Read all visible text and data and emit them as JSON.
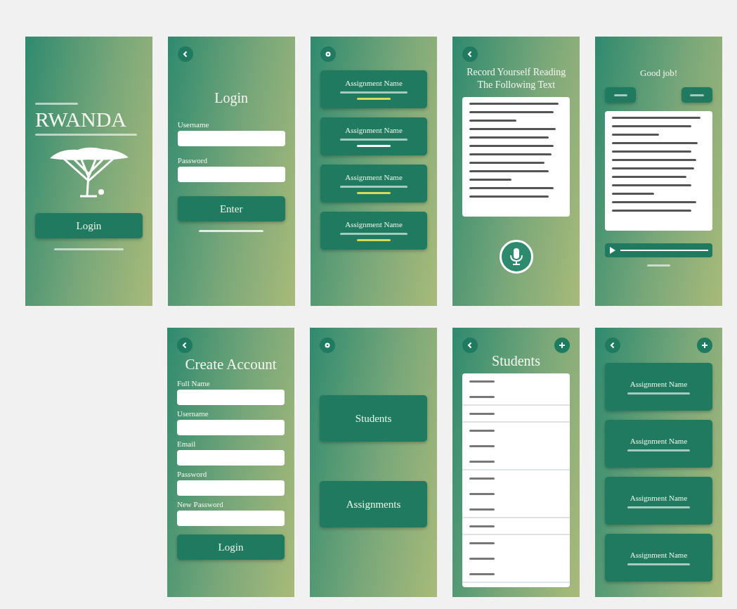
{
  "rows": [
    [
      {
        "kind": "splash",
        "title": "RWANDA",
        "button": "Login"
      },
      {
        "kind": "login",
        "title": "Login",
        "fields": [
          {
            "label": "Username"
          },
          {
            "label": "Password"
          }
        ],
        "button": "Enter"
      },
      {
        "kind": "status_list",
        "cards": [
          {
            "title": "Assignment Name",
            "color": "#d8d85a"
          },
          {
            "title": "Assignment Name",
            "color": "#ffffff"
          },
          {
            "title": "Assignment Name",
            "color": "#d8d85a"
          },
          {
            "title": "Assignment Name",
            "color": "#d8d85a"
          }
        ]
      },
      {
        "kind": "record",
        "title": "Record Yourself Reading The Following Text"
      },
      {
        "kind": "result",
        "title": "Good job!"
      }
    ],
    [
      {
        "kind": "create",
        "title": "Create Account",
        "fields": [
          {
            "label": "Full Name"
          },
          {
            "label": "Username"
          },
          {
            "label": "Email"
          },
          {
            "label": "Password"
          },
          {
            "label": "New Password"
          }
        ],
        "button": "Login"
      },
      {
        "kind": "home",
        "buttons": [
          "Students",
          "Assignments"
        ]
      },
      {
        "kind": "students",
        "title": "Students"
      },
      {
        "kind": "assignments",
        "cards": [
          {
            "title": "Assignment Name"
          },
          {
            "title": "Assignment Name"
          },
          {
            "title": "Assignment Name"
          },
          {
            "title": "Assignment Name"
          }
        ]
      }
    ]
  ]
}
